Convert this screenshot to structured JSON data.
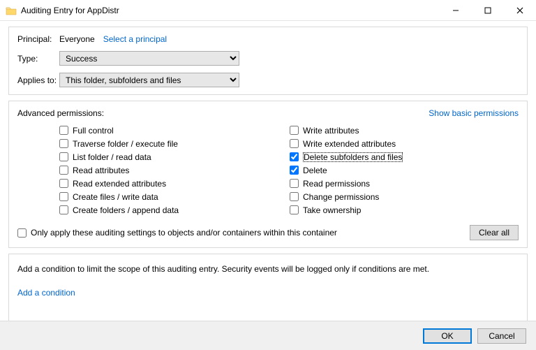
{
  "windowTitle": "Auditing Entry for AppDistr",
  "topGroup": {
    "principalLabel": "Principal:",
    "principalValue": "Everyone",
    "selectPrincipalLink": "Select a principal",
    "typeLabel": "Type:",
    "typeValue": "Success",
    "appliesToLabel": "Applies to:",
    "appliesToValue": "This folder, subfolders and files"
  },
  "permGroup": {
    "heading": "Advanced permissions:",
    "showBasicLink": "Show basic permissions",
    "left": [
      {
        "label": "Full control",
        "checked": false
      },
      {
        "label": "Traverse folder / execute file",
        "checked": false
      },
      {
        "label": "List folder / read data",
        "checked": false
      },
      {
        "label": "Read attributes",
        "checked": false
      },
      {
        "label": "Read extended attributes",
        "checked": false
      },
      {
        "label": "Create files / write data",
        "checked": false
      },
      {
        "label": "Create folders / append data",
        "checked": false
      }
    ],
    "right": [
      {
        "label": "Write attributes",
        "checked": false
      },
      {
        "label": "Write extended attributes",
        "checked": false
      },
      {
        "label": "Delete subfolders and files",
        "checked": true
      },
      {
        "label": "Delete",
        "checked": true
      },
      {
        "label": "Read permissions",
        "checked": false
      },
      {
        "label": "Change permissions",
        "checked": false
      },
      {
        "label": "Take ownership",
        "checked": false
      }
    ],
    "onlyThisContainer": "Only apply these auditing settings to objects and/or containers within this container",
    "clearAll": "Clear all"
  },
  "condGroup": {
    "desc": "Add a condition to limit the scope of this auditing entry. Security events will be logged only if conditions are met.",
    "addLink": "Add a condition"
  },
  "buttons": {
    "ok": "OK",
    "cancel": "Cancel"
  }
}
